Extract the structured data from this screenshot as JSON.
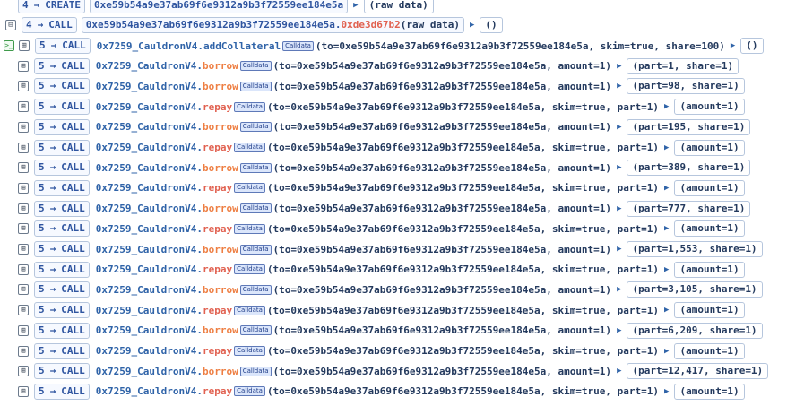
{
  "header_rows": [
    {
      "depth": "4",
      "type": "CREATE",
      "address": "0xe59b54a9e37ab69f6e9312a9b3f72559ee184e5a",
      "raw": "(raw data)"
    },
    {
      "depth": "4",
      "type": "CALL",
      "address": "0xe59b54a9e37ab69f6e9312a9b3f72559ee184e5a",
      "dot": ".",
      "selector": "0xde3d67b2",
      "raw": "(raw data)",
      "result": "()"
    }
  ],
  "call_rows": [
    {
      "depth": "5",
      "type": "CALL",
      "contract": "0x7259_CauldronV4",
      "dot": ".",
      "fn": "addCollateral",
      "cd": "Calldata",
      "args": "(to=0xe59b54a9e37ab69f6e9312a9b3f72559ee184e5a, skim=true, share=100)",
      "result": "()"
    },
    {
      "depth": "5",
      "type": "CALL",
      "contract": "0x7259_CauldronV4",
      "dot": ".",
      "fn": "borrow",
      "cd": "Calldata",
      "args": "(to=0xe59b54a9e37ab69f6e9312a9b3f72559ee184e5a, amount=1)",
      "result": "(part=1, share=1)"
    },
    {
      "depth": "5",
      "type": "CALL",
      "contract": "0x7259_CauldronV4",
      "dot": ".",
      "fn": "borrow",
      "cd": "Calldata",
      "args": "(to=0xe59b54a9e37ab69f6e9312a9b3f72559ee184e5a, amount=1)",
      "result": "(part=98, share=1)"
    },
    {
      "depth": "5",
      "type": "CALL",
      "contract": "0x7259_CauldronV4",
      "dot": ".",
      "fn": "repay",
      "cd": "Calldata",
      "args": "(to=0xe59b54a9e37ab69f6e9312a9b3f72559ee184e5a, skim=true, part=1)",
      "result": "(amount=1)"
    },
    {
      "depth": "5",
      "type": "CALL",
      "contract": "0x7259_CauldronV4",
      "dot": ".",
      "fn": "borrow",
      "cd": "Calldata",
      "args": "(to=0xe59b54a9e37ab69f6e9312a9b3f72559ee184e5a, amount=1)",
      "result": "(part=195, share=1)"
    },
    {
      "depth": "5",
      "type": "CALL",
      "contract": "0x7259_CauldronV4",
      "dot": ".",
      "fn": "repay",
      "cd": "Calldata",
      "args": "(to=0xe59b54a9e37ab69f6e9312a9b3f72559ee184e5a, skim=true, part=1)",
      "result": "(amount=1)"
    },
    {
      "depth": "5",
      "type": "CALL",
      "contract": "0x7259_CauldronV4",
      "dot": ".",
      "fn": "borrow",
      "cd": "Calldata",
      "args": "(to=0xe59b54a9e37ab69f6e9312a9b3f72559ee184e5a, amount=1)",
      "result": "(part=389, share=1)"
    },
    {
      "depth": "5",
      "type": "CALL",
      "contract": "0x7259_CauldronV4",
      "dot": ".",
      "fn": "repay",
      "cd": "Calldata",
      "args": "(to=0xe59b54a9e37ab69f6e9312a9b3f72559ee184e5a, skim=true, part=1)",
      "result": "(amount=1)"
    },
    {
      "depth": "5",
      "type": "CALL",
      "contract": "0x7259_CauldronV4",
      "dot": ".",
      "fn": "borrow",
      "cd": "Calldata",
      "args": "(to=0xe59b54a9e37ab69f6e9312a9b3f72559ee184e5a, amount=1)",
      "result": "(part=777, share=1)"
    },
    {
      "depth": "5",
      "type": "CALL",
      "contract": "0x7259_CauldronV4",
      "dot": ".",
      "fn": "repay",
      "cd": "Calldata",
      "args": "(to=0xe59b54a9e37ab69f6e9312a9b3f72559ee184e5a, skim=true, part=1)",
      "result": "(amount=1)"
    },
    {
      "depth": "5",
      "type": "CALL",
      "contract": "0x7259_CauldronV4",
      "dot": ".",
      "fn": "borrow",
      "cd": "Calldata",
      "args": "(to=0xe59b54a9e37ab69f6e9312a9b3f72559ee184e5a, amount=1)",
      "result": "(part=1,553, share=1)"
    },
    {
      "depth": "5",
      "type": "CALL",
      "contract": "0x7259_CauldronV4",
      "dot": ".",
      "fn": "repay",
      "cd": "Calldata",
      "args": "(to=0xe59b54a9e37ab69f6e9312a9b3f72559ee184e5a, skim=true, part=1)",
      "result": "(amount=1)"
    },
    {
      "depth": "5",
      "type": "CALL",
      "contract": "0x7259_CauldronV4",
      "dot": ".",
      "fn": "borrow",
      "cd": "Calldata",
      "args": "(to=0xe59b54a9e37ab69f6e9312a9b3f72559ee184e5a, amount=1)",
      "result": "(part=3,105, share=1)"
    },
    {
      "depth": "5",
      "type": "CALL",
      "contract": "0x7259_CauldronV4",
      "dot": ".",
      "fn": "repay",
      "cd": "Calldata",
      "args": "(to=0xe59b54a9e37ab69f6e9312a9b3f72559ee184e5a, skim=true, part=1)",
      "result": "(amount=1)"
    },
    {
      "depth": "5",
      "type": "CALL",
      "contract": "0x7259_CauldronV4",
      "dot": ".",
      "fn": "borrow",
      "cd": "Calldata",
      "args": "(to=0xe59b54a9e37ab69f6e9312a9b3f72559ee184e5a, amount=1)",
      "result": "(part=6,209, share=1)"
    },
    {
      "depth": "5",
      "type": "CALL",
      "contract": "0x7259_CauldronV4",
      "dot": ".",
      "fn": "repay",
      "cd": "Calldata",
      "args": "(to=0xe59b54a9e37ab69f6e9312a9b3f72559ee184e5a, skim=true, part=1)",
      "result": "(amount=1)"
    },
    {
      "depth": "5",
      "type": "CALL",
      "contract": "0x7259_CauldronV4",
      "dot": ".",
      "fn": "borrow",
      "cd": "Calldata",
      "args": "(to=0xe59b54a9e37ab69f6e9312a9b3f72559ee184e5a, amount=1)",
      "result": "(part=12,417, share=1)"
    },
    {
      "depth": "5",
      "type": "CALL",
      "contract": "0x7259_CauldronV4",
      "dot": ".",
      "fn": "repay",
      "cd": "Calldata",
      "args": "(to=0xe59b54a9e37ab69f6e9312a9b3f72559ee184e5a, skim=true, part=1)",
      "result": "(amount=1)"
    }
  ],
  "icons": {
    "expand": "⊞",
    "collapse": "⊟",
    "terminal": ">_",
    "arrow": "▶"
  },
  "colors": {
    "borrow": "#ee7f43",
    "repay": "#e16150",
    "addCollateral": "#2f63a8"
  }
}
